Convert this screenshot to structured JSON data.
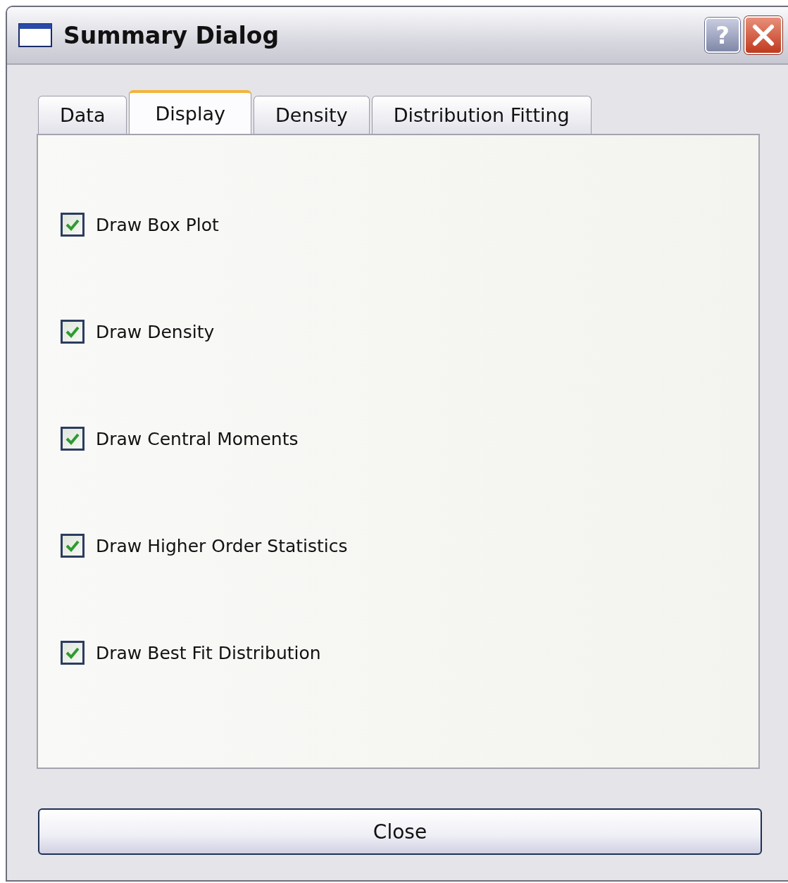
{
  "window": {
    "title": "Summary Dialog",
    "help_button": "?"
  },
  "tabs": [
    {
      "label": "Data",
      "selected": false
    },
    {
      "label": "Display",
      "selected": true
    },
    {
      "label": "Density",
      "selected": false
    },
    {
      "label": "Distribution Fitting",
      "selected": false
    }
  ],
  "options": [
    {
      "label": "Draw Box Plot",
      "checked": true
    },
    {
      "label": "Draw Density",
      "checked": true
    },
    {
      "label": "Draw Central Moments",
      "checked": true
    },
    {
      "label": "Draw Higher Order Statistics",
      "checked": true
    },
    {
      "label": "Draw Best Fit Distribution",
      "checked": true
    }
  ],
  "buttons": [
    "Close"
  ]
}
